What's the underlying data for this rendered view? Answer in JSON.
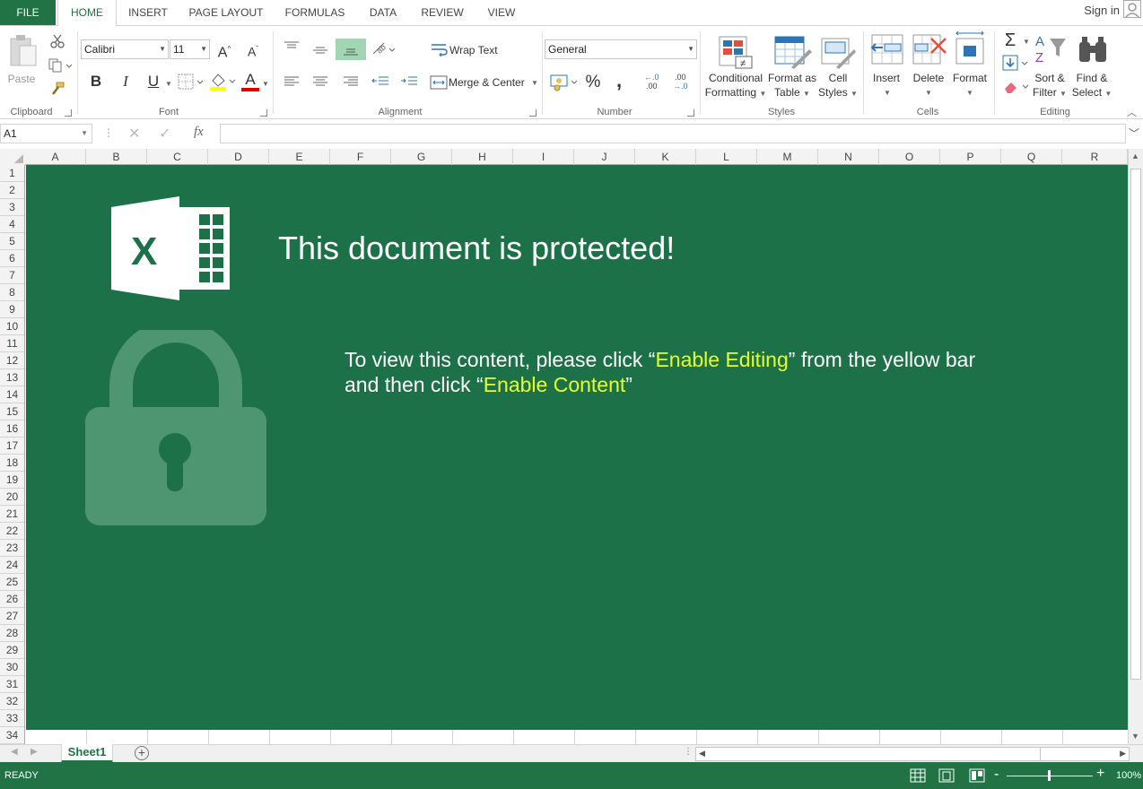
{
  "tabs": {
    "file": "FILE",
    "home": "HOME",
    "insert": "INSERT",
    "page_layout": "PAGE LAYOUT",
    "formulas": "FORMULAS",
    "data": "DATA",
    "review": "REVIEW",
    "view": "VIEW",
    "sign_in": "Sign in"
  },
  "ribbon": {
    "clipboard": {
      "paste": "Paste",
      "label": "Clipboard"
    },
    "font": {
      "name": "Calibri",
      "size": "11",
      "bold": "B",
      "italic": "I",
      "underline": "U",
      "grow": "A",
      "shrink": "A",
      "color_letter": "A",
      "label": "Font"
    },
    "alignment": {
      "wrap_text": "Wrap Text",
      "merge_center": "Merge & Center",
      "label": "Alignment"
    },
    "number": {
      "format": "General",
      "percent": "%",
      "comma": ",",
      "inc_decimal": "←.0\n.00",
      "dec_decimal": ".00\n→.0",
      "label": "Number"
    },
    "styles": {
      "conditional_1": "Conditional",
      "conditional_2": "Formatting",
      "table_1": "Format as",
      "table_2": "Table",
      "cell_1": "Cell",
      "cell_2": "Styles",
      "label": "Styles"
    },
    "cells": {
      "insert": "Insert",
      "delete": "Delete",
      "format": "Format",
      "label": "Cells"
    },
    "editing": {
      "sort_1": "Sort &",
      "sort_2": "Filter",
      "find_1": "Find &",
      "find_2": "Select",
      "sigma": "Σ",
      "label": "Editing"
    }
  },
  "formula_bar": {
    "name_box": "A1",
    "fx": "fx",
    "value": ""
  },
  "columns": [
    "A",
    "B",
    "C",
    "D",
    "E",
    "F",
    "G",
    "H",
    "I",
    "J",
    "K",
    "L",
    "M",
    "N",
    "O",
    "P",
    "Q",
    "R"
  ],
  "rows": [
    "1",
    "2",
    "3",
    "4",
    "5",
    "6",
    "7",
    "8",
    "9",
    "10",
    "11",
    "12",
    "13",
    "14",
    "15",
    "16",
    "17",
    "18",
    "19",
    "20",
    "21",
    "22",
    "23",
    "24",
    "25",
    "26",
    "27",
    "28",
    "29",
    "30",
    "31",
    "32",
    "33",
    "34"
  ],
  "content": {
    "logo_letter": "X",
    "headline": "This document is protected!",
    "line1_prefix": "To view this content, please click “",
    "line1_highlight": "Enable Editing",
    "line1_suffix": "” from the yellow bar",
    "line2_prefix": "and then click “",
    "line2_highlight": "Enable Content",
    "line2_suffix": "”",
    "highlight_color": "#e5ff2b",
    "background_color": "#1d7148"
  },
  "sheets": {
    "active": "Sheet1",
    "add": "+"
  },
  "status": {
    "text": "READY",
    "zoom": "100%",
    "zoom_minus": "-",
    "zoom_plus": "+"
  },
  "colors": {
    "excel_green": "#217346"
  }
}
